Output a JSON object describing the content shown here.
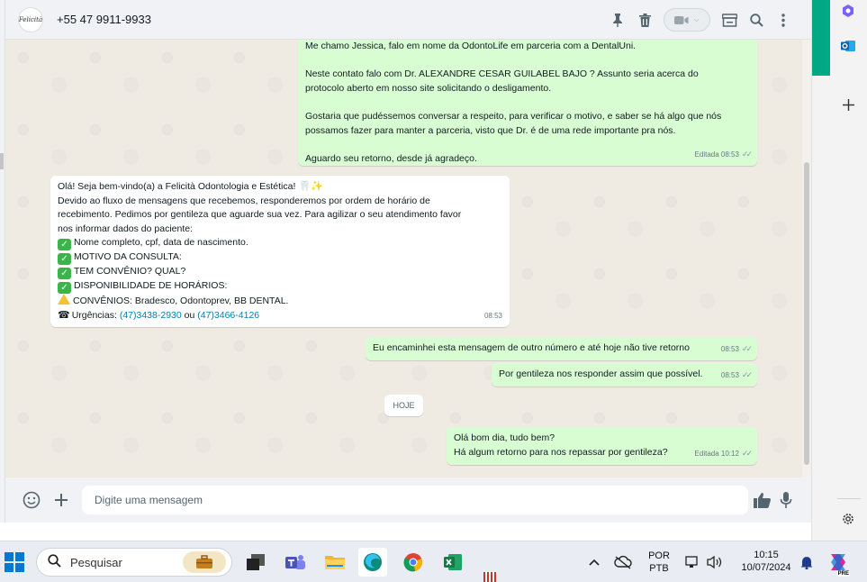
{
  "header": {
    "avatar_text": "Felicità",
    "contact": "+55 47 9911-9933"
  },
  "messages": {
    "m1": {
      "lines": [
        "Me chamo Jessica, falo em nome da OdontoLife em parceria com a DentalUni.",
        "",
        "Neste contato falo com Dr. ALEXANDRE CESAR GUILABEL BAJO ? Assunto seria acerca do",
        "protocolo aberto em nosso site solicitando o desligamento.",
        "",
        "Gostaria que pudéssemos conversar a respeito, para verificar o motivo, e saber se há algo que nós",
        "possamos fazer para manter a parceria, visto que Dr. é de uma rede importante pra nós.",
        "",
        "Aguardo seu retorno, desde já agradeço."
      ],
      "meta": "Editada 08:53"
    },
    "m2": {
      "l1": "Olá! Seja bem-vindo(a) a Felicità Odontologia e Estética!",
      "l2": "Devido ao fluxo de mensagens que recebemos, responderemos  por ordem de horário de",
      "l3": "recebimento. Pedimos por gentileza que aguarde sua vez.  Para agilizar o seu atendimento favor",
      "l4": "nos informar dados do paciente:",
      "c1": "Nome completo, cpf, data de nascimento.",
      "c2": "MOTIVO DA CONSULTA:",
      "c3": "TEM CONVÊNIO? QUAL?",
      "c4": "DISPONIBILIDADE DE HORÁRIOS:",
      "warn": "CONVÊNIOS: Bradesco, Odontoprev, BB DENTAL.",
      "urg_label": "Urgências:",
      "phone1": "(47)3438-2930",
      "or": " ou ",
      "phone2": "(47)3466-4126",
      "meta": "08:53"
    },
    "m3": {
      "text": "Eu encaminhei esta mensagem de outro número e até hoje não tive retorno",
      "meta": "08:53"
    },
    "m4": {
      "text": "Por gentileza nos responder assim que possível.",
      "meta": "08:53"
    },
    "day": "HOJE",
    "m5": {
      "l1": "Olá bom dia, tudo bem?",
      "l2": "Há algum retorno para nos repassar por gentileza?",
      "meta": "Editada 10:12"
    }
  },
  "composer": {
    "placeholder": "Digite uma mensagem"
  },
  "taskbar": {
    "search": "Pesquisar",
    "lang1": "POR",
    "lang2": "PTB",
    "time": "10:15",
    "date": "10/07/2024",
    "copilot_badge": "PRE"
  },
  "colors": {
    "accent": "#00a884",
    "outgoing": "#d9fdd3",
    "link": "#027eb5"
  }
}
